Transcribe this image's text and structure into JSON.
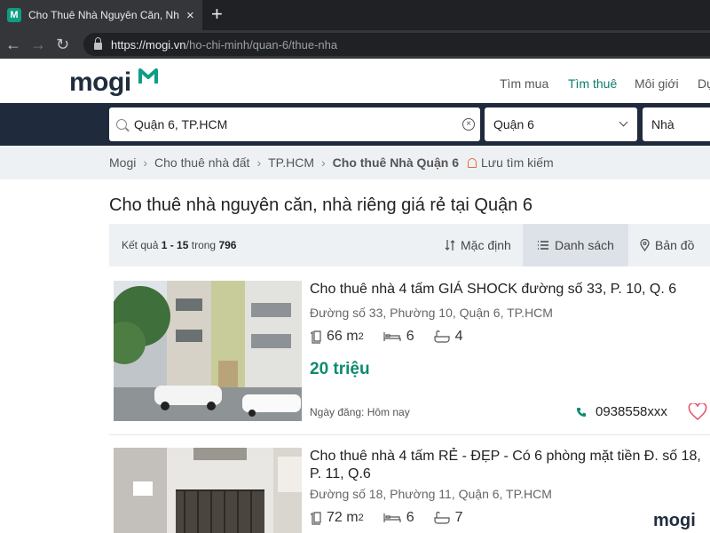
{
  "browser": {
    "tab_title": "Cho Thuê Nhà Nguyên Căn, Nhà",
    "tab_close": "×",
    "new_tab": "+",
    "url_host": "https://mogi.vn",
    "url_path": "/ho-chi-minh/quan-6/thue-nha"
  },
  "site": {
    "logo": "mogi",
    "nav": [
      "Tìm mua",
      "Tìm thuê",
      "Môi giới",
      "Dự"
    ],
    "active_nav": "Tìm thuê",
    "brand_color": "#0d9e85"
  },
  "search": {
    "location": "Quận 6, TP.HCM",
    "district": "Quận 6",
    "type": "Nhà"
  },
  "breadcrumb": {
    "items": [
      "Mogi",
      "Cho thuê nhà đất",
      "TP.HCM",
      "Cho thuê Nhà Quận 6"
    ],
    "save_search": "Lưu tìm kiếm"
  },
  "page": {
    "title": "Cho thuê nhà nguyên căn, nhà riêng giá rẻ tại Quận 6",
    "result_prefix": "Kết quả",
    "result_range": "1 - 15",
    "result_mid": "trong",
    "result_total": "796",
    "sort_default": "Mặc định",
    "view_list": "Danh sách",
    "view_map": "Bản đồ"
  },
  "listings": [
    {
      "title": "Cho thuê nhà 4 tấm GIÁ SHOCK đường số 33, P. 10, Q. 6",
      "address": "Đường số 33, Phường 10, Quận 6, TP.HCM",
      "area": "66 m",
      "area_sup": "2",
      "bedrooms": "6",
      "bathrooms": "4",
      "price": "20 triệu",
      "date": "Ngày đăng: Hôm nay",
      "phone": "0938558xxx"
    },
    {
      "title_line1": "Cho thuê nhà 4 tấm RẺ - ĐẸP - Có 6 phòng mặt tiền Đ. số 18,",
      "title_line2": "P. 11, Q.6",
      "address": "Đường số 18, Phường 11, Quận 6, TP.HCM",
      "area": "72 m",
      "area_sup": "2",
      "bedrooms": "6",
      "bathrooms": "7"
    }
  ],
  "watermark": "mogi",
  "icons": {
    "price_color": "#0b8a6f",
    "heart_color": "#e8546b",
    "bell_color": "#e66a3c"
  }
}
